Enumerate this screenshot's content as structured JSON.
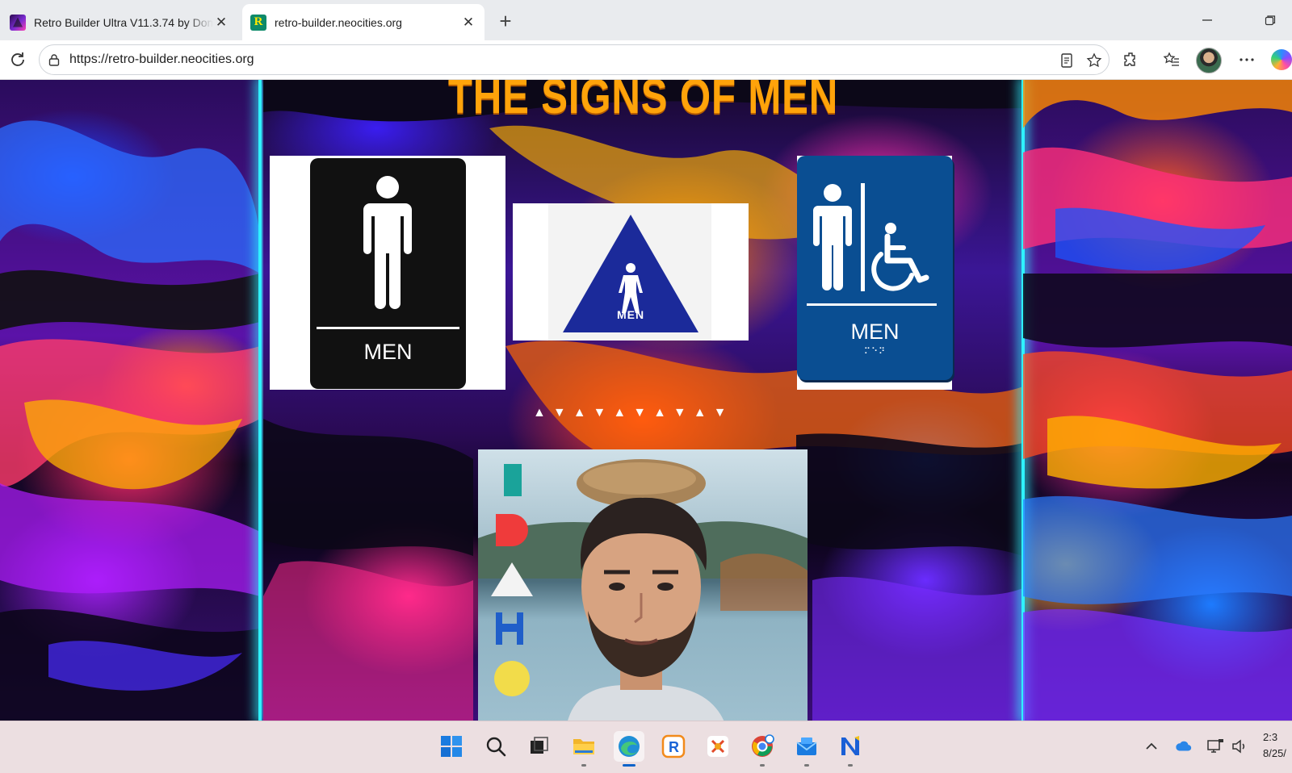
{
  "browser": {
    "tabs": [
      {
        "title": "Retro Builder Ultra V11.3.74 by Dom",
        "active": false
      },
      {
        "title": "retro-builder.neocities.org",
        "active": true
      }
    ],
    "address": "https://retro-builder.neocities.org"
  },
  "page": {
    "title": "THE SIGNS OF MEN",
    "signs": [
      {
        "label": "MEN",
        "style": "black rectangle"
      },
      {
        "label": "MEN",
        "style": "blue triangle"
      },
      {
        "label": "MEN",
        "style": "blue accessible"
      }
    ],
    "markers": [
      "▲",
      "▼",
      "▲",
      "▼",
      "▲",
      "▼",
      "▲",
      "▼",
      "▲",
      "▼"
    ]
  },
  "taskbar": {
    "apps": [
      "windows-start",
      "search",
      "task-view",
      "file-explorer",
      "edge",
      "retro-app",
      "tool-app",
      "chrome",
      "outlook",
      "notepad-plus"
    ],
    "clock_time": "2:3",
    "clock_date": "8/25/"
  },
  "colors": {
    "title": "#ffa30a",
    "glow": "#2ff2ff",
    "sign_blue": "#0a4e92",
    "triangle_blue": "#1b2a9a"
  }
}
